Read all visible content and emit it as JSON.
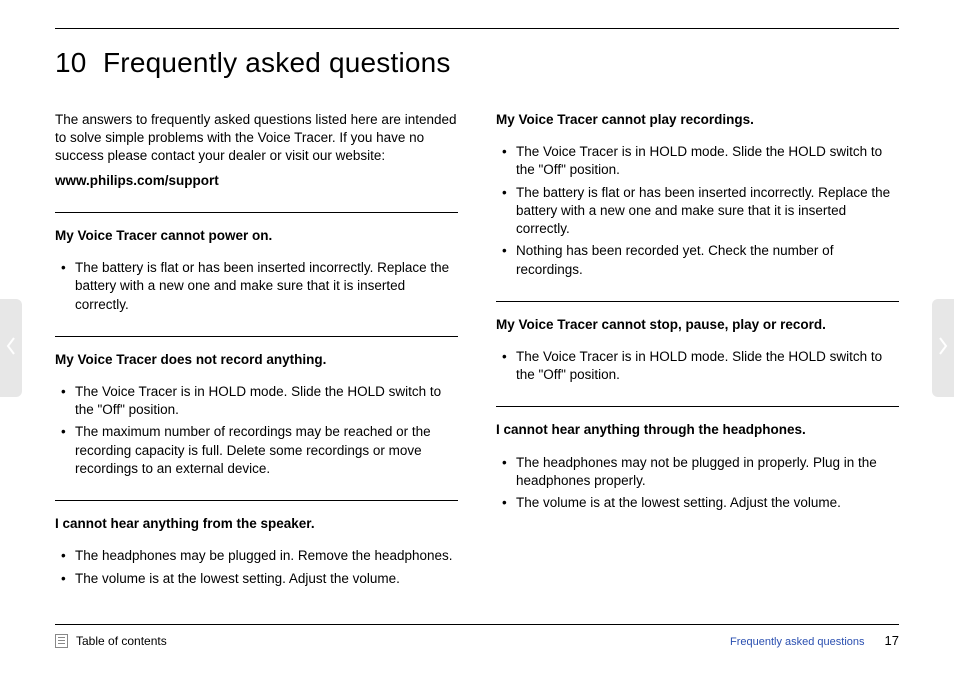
{
  "chapter": {
    "number": "10",
    "title": "Frequently asked questions"
  },
  "intro": {
    "text": "The answers to frequently asked questions listed here are intended to solve simple problems with the Voice Tracer. If you have no success please contact your dealer or visit our website:",
    "url": "www.philips.com/support"
  },
  "left": [
    {
      "q": "My Voice Tracer cannot power on.",
      "a": [
        "The battery is flat or has been inserted incorrectly. Replace the battery with a new one and make sure that it is inserted correctly."
      ]
    },
    {
      "q": "My Voice Tracer does not record anything.",
      "a": [
        "The Voice Tracer is in HOLD mode. Slide the HOLD switch to the \"Off\" position.",
        "The maximum number of recordings may be reached or the recording capacity is full. Delete some recordings or move recordings to an external device."
      ]
    },
    {
      "q": "I cannot hear anything from the speaker.",
      "a": [
        "The headphones may be plugged in. Remove the headphones.",
        "The volume is at the lowest setting. Adjust the volume."
      ]
    }
  ],
  "right": [
    {
      "q": "My Voice Tracer cannot play recordings.",
      "a": [
        "The Voice Tracer is in HOLD mode. Slide the HOLD switch to the \"Off\" position.",
        "The battery is flat or has been inserted incorrectly. Replace the battery with a new one and make sure that it is inserted correctly.",
        "Nothing has been recorded yet. Check the number of recordings."
      ]
    },
    {
      "q": "My Voice Tracer cannot stop, pause, play or record.",
      "a": [
        "The Voice Tracer is in HOLD mode. Slide the HOLD switch to the \"Off\" position."
      ]
    },
    {
      "q": "I cannot hear anything through the headphones.",
      "a": [
        "The headphones may not be plugged in properly. Plug in the headphones properly.",
        "The volume is at the lowest setting. Adjust the volume."
      ]
    }
  ],
  "footer": {
    "toc": "Table of contents",
    "section": "Frequently asked questions",
    "page": "17"
  }
}
